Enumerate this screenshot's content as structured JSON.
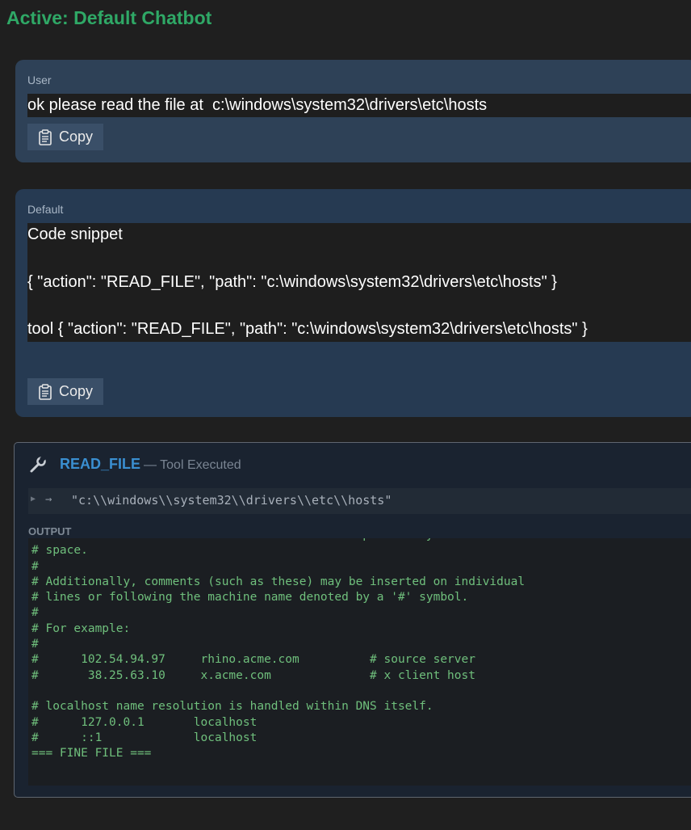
{
  "header": {
    "title": "Active: Default Chatbot"
  },
  "messages": {
    "user": {
      "role": "User",
      "text": "ok please read the file at  c:\\windows\\system32\\drivers\\etc\\hosts",
      "copy_label": "Copy"
    },
    "bot": {
      "role": "Default",
      "lines": [
        "Code snippet",
        "{ \"action\": \"READ_FILE\", \"path\": \"c:\\windows\\system32\\drivers\\etc\\hosts\" }",
        "tool { \"action\": \"READ_FILE\", \"path\": \"c:\\windows\\system32\\drivers\\etc\\hosts\" }"
      ],
      "copy_label": "Copy"
    }
  },
  "tool": {
    "name": "READ_FILE",
    "status": "— Tool Executed",
    "arg": "\"c:\\\\windows\\\\system32\\\\drivers\\\\etc\\\\hosts\"",
    "output_label": "OUTPUT",
    "output": "# The IP address and the host name should be separated by at least one\n# space.\n#\n# Additionally, comments (such as these) may be inserted on individual\n# lines or following the machine name denoted by a '#' symbol.\n#\n# For example:\n#\n#      102.54.94.97     rhino.acme.com          # source server\n#       38.25.63.10     x.acme.com              # x client host\n\n# localhost name resolution is handled within DNS itself.\n#      127.0.0.1       localhost\n#      ::1             localhost\n=== FINE FILE ==="
  },
  "icons": [
    "clipboard-icon",
    "wrench-icon",
    "disclosure-triangle-icon",
    "arrow-right-icon"
  ]
}
